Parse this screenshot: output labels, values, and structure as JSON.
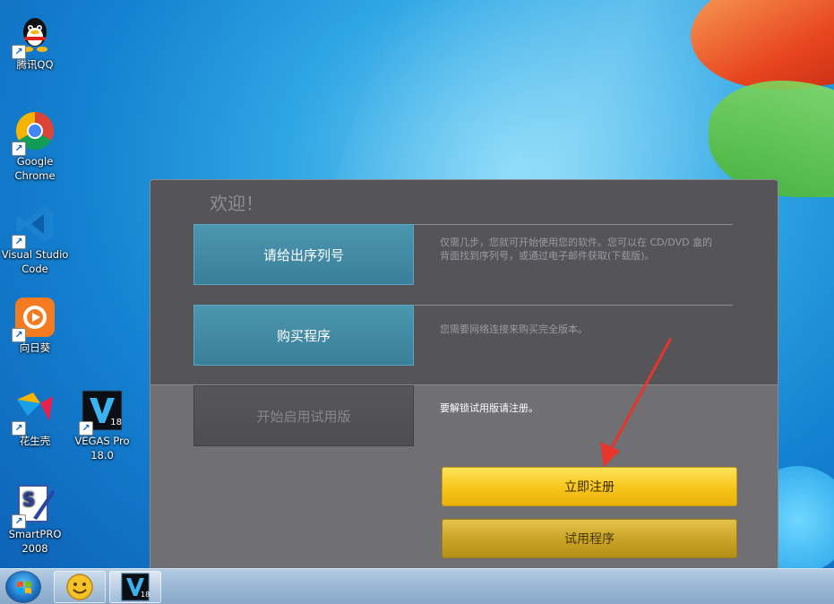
{
  "desktop": {
    "icons": [
      {
        "label": "腾讯QQ"
      },
      {
        "label": "Google Chrome"
      },
      {
        "label": "Visual Studio Code"
      },
      {
        "label": "向日葵"
      },
      {
        "label": "花生壳"
      },
      {
        "label": "VEGAS Pro 18.0"
      },
      {
        "label": "SmartPRO 2008"
      }
    ],
    "vegas_badge": "18"
  },
  "dialog": {
    "welcome": "欢迎！",
    "options": [
      {
        "label": "请给出序列号",
        "description": "仅需几步，您就可开始使用您的软件。您可以在 CD/DVD 盒的背面找到序列号，或通过电子邮件获取(下载版)。"
      },
      {
        "label": "购买程序",
        "description": "您需要网络连接来购买完全版本。"
      },
      {
        "label": "开始启用试用版",
        "description": "要解锁试用版请注册。"
      }
    ],
    "register_now": "立即注册",
    "trial_program": "试用程序"
  },
  "taskbar": {
    "vegas_badge": "18"
  },
  "colors": {
    "dialog_dark": "#545459",
    "dialog_light": "#6f6f74",
    "option_blue": "#4c96b0",
    "gold": "#f7c51a",
    "arrow_red": "#e8352c"
  }
}
